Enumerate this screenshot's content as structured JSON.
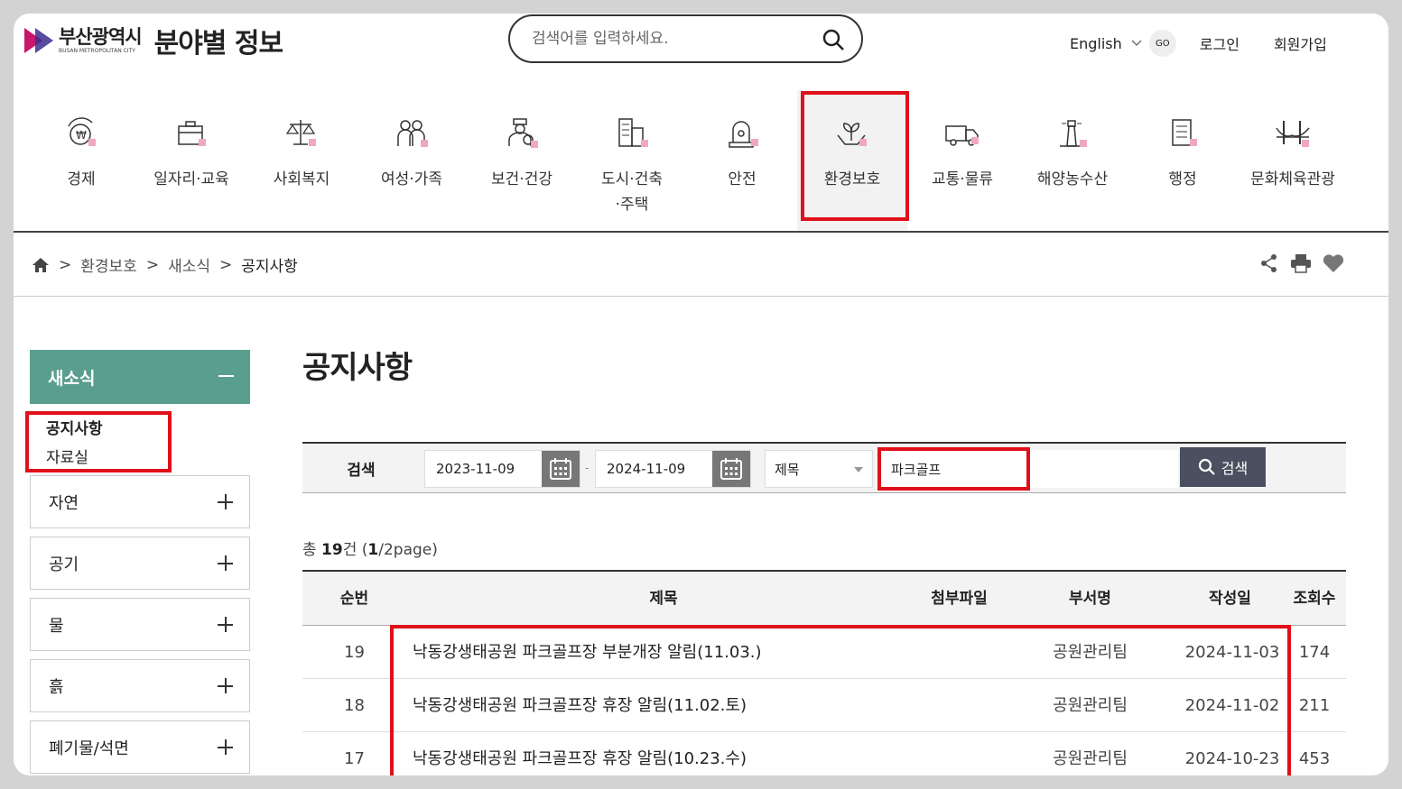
{
  "header": {
    "logo_ko": "부산광역시",
    "logo_en": "BUSAN METROPOLITAN CITY",
    "site_title": "분야별 정보",
    "search_placeholder": "검색어를 입력하세요.",
    "language": "English",
    "go": "GO",
    "login": "로그인",
    "signup": "회원가입"
  },
  "categories": [
    {
      "label": "경제",
      "icon": "economy-icon"
    },
    {
      "label": "일자리·교육",
      "icon": "briefcase-icon"
    },
    {
      "label": "사회복지",
      "icon": "scale-icon"
    },
    {
      "label": "여성·가족",
      "icon": "family-icon"
    },
    {
      "label": "보건·건강",
      "icon": "health-icon"
    },
    {
      "label": "도시·건축·주택",
      "icon": "building-icon"
    },
    {
      "label": "안전",
      "icon": "siren-icon"
    },
    {
      "label": "환경보호",
      "icon": "plant-hand-icon"
    },
    {
      "label": "교통·물류",
      "icon": "truck-icon"
    },
    {
      "label": "해양농수산",
      "icon": "lighthouse-icon"
    },
    {
      "label": "행정",
      "icon": "document-icon"
    },
    {
      "label": "문화체육관광",
      "icon": "bridge-icon"
    }
  ],
  "active_category": "환경보호",
  "breadcrumb": [
    "환경보호",
    "새소식",
    "공지사항"
  ],
  "sidebar": {
    "section": "새소식",
    "sub_items": [
      "공지사항",
      "자료실"
    ],
    "groups": [
      "자연",
      "공기",
      "물",
      "흙",
      "폐기물/석면"
    ]
  },
  "main": {
    "title": "공지사항",
    "search_label": "검색",
    "date_from": "2023-11-09",
    "date_sep": "-",
    "date_to": "2024-11-09",
    "field": "제목",
    "keyword": "파크골프",
    "search_button": "검색",
    "count_prefix": "총 ",
    "count_num": "19",
    "count_mid": "건 (",
    "count_page": "1",
    "count_suffix": "/2page)"
  },
  "table": {
    "headers": [
      "순번",
      "제목",
      "첨부파일",
      "부서명",
      "작성일",
      "조회수"
    ],
    "rows": [
      {
        "no": "19",
        "title": "낙동강생태공원 파크골프장 부분개장 알림(11.03.)",
        "dept": "공원관리팀",
        "date": "2024-11-03",
        "views": "174"
      },
      {
        "no": "18",
        "title": "낙동강생태공원 파크골프장 휴장 알림(11.02.토)",
        "dept": "공원관리팀",
        "date": "2024-11-02",
        "views": "211"
      },
      {
        "no": "17",
        "title": "낙동강생태공원 파크골프장 휴장 알림(10.23.수)",
        "dept": "공원관리팀",
        "date": "2024-10-23",
        "views": "453"
      }
    ]
  },
  "colors": {
    "accent": "#5a9e8e",
    "highlight": "#e0101a",
    "button": "#4a5060"
  }
}
